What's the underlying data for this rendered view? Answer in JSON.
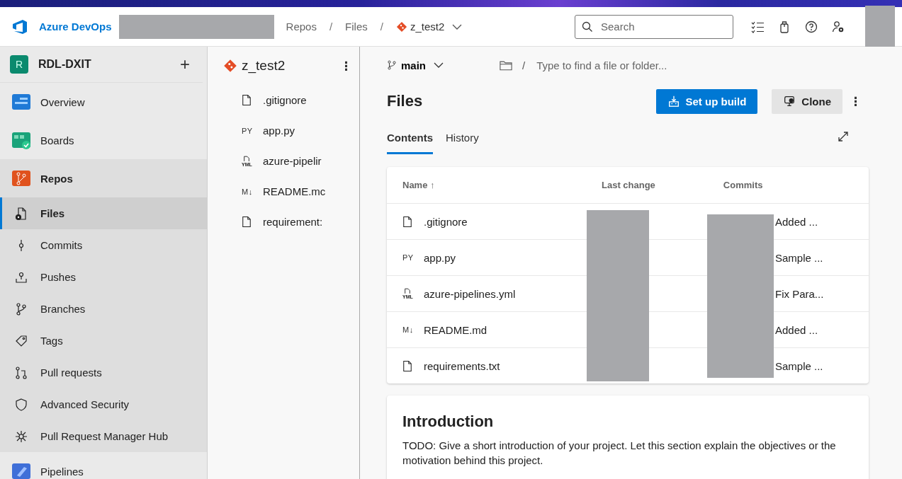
{
  "header": {
    "product": "Azure DevOps",
    "breadcrumbs": [
      "Repos",
      "/",
      "Files",
      "/"
    ],
    "repo": "z_test2",
    "search": {
      "placeholder": "Search"
    }
  },
  "project": {
    "initial": "R",
    "name": "RDL-DXIT",
    "add": "+"
  },
  "nav": [
    {
      "label": "Overview",
      "selected": false
    },
    {
      "label": "Boards",
      "selected": false
    },
    {
      "label": "Repos",
      "selected": false,
      "expanded": true,
      "children": [
        {
          "label": "Files",
          "selected": true
        },
        {
          "label": "Commits",
          "selected": false
        },
        {
          "label": "Pushes",
          "selected": false
        },
        {
          "label": "Branches",
          "selected": false
        },
        {
          "label": "Tags",
          "selected": false
        },
        {
          "label": "Pull requests",
          "selected": false
        },
        {
          "label": "Advanced Security",
          "selected": false
        },
        {
          "label": "Pull Request Manager Hub",
          "selected": false
        }
      ]
    },
    {
      "label": "Pipelines",
      "selected": false
    }
  ],
  "tree": {
    "repo": "z_test2",
    "more": "⋮",
    "files": [
      {
        "name": ".gitignore",
        "kind": "doc"
      },
      {
        "name": "app.py",
        "kind": "label",
        "icon_text": "PY"
      },
      {
        "name": "azure-pipelir",
        "kind": "doc_label",
        "icon_text": "YML"
      },
      {
        "name": "README.mc",
        "kind": "label",
        "icon_text": "M↓"
      },
      {
        "name": "requirement:",
        "kind": "doc"
      }
    ]
  },
  "main": {
    "branch": "main",
    "path_placeholder": "Type to find a file or folder...",
    "separator": "/",
    "title": "Files",
    "buttons": [
      {
        "label": "Set up build",
        "kind": "primary"
      },
      {
        "label": "Clone",
        "kind": "secondary"
      }
    ],
    "more": "⋮",
    "tabs": [
      {
        "label": "Contents",
        "selected": true
      },
      {
        "label": "History",
        "selected": false
      }
    ],
    "table": {
      "columns": [
        "Name ↑",
        "Last change",
        "Commits"
      ],
      "rows": [
        {
          "name": ".gitignore",
          "kind": "doc",
          "column_4": "Added ..."
        },
        {
          "name": "app.py",
          "kind": "label",
          "icon_text": "PY",
          "column_4": "Sample ..."
        },
        {
          "name": "azure-pipelines.yml",
          "kind": "doc_label",
          "icon_text": "YML",
          "column_4": "Fix Para..."
        },
        {
          "name": "README.md",
          "kind": "label",
          "icon_text": "M↓",
          "column_4": "Added ..."
        },
        {
          "name": "requirements.txt",
          "kind": "doc",
          "column_4": "Sample ..."
        }
      ]
    },
    "readme": {
      "heading": "Introduction",
      "text": "TODO: Give a short introduction of your project. Let this section explain the objectives or the motivation behind this project."
    }
  }
}
